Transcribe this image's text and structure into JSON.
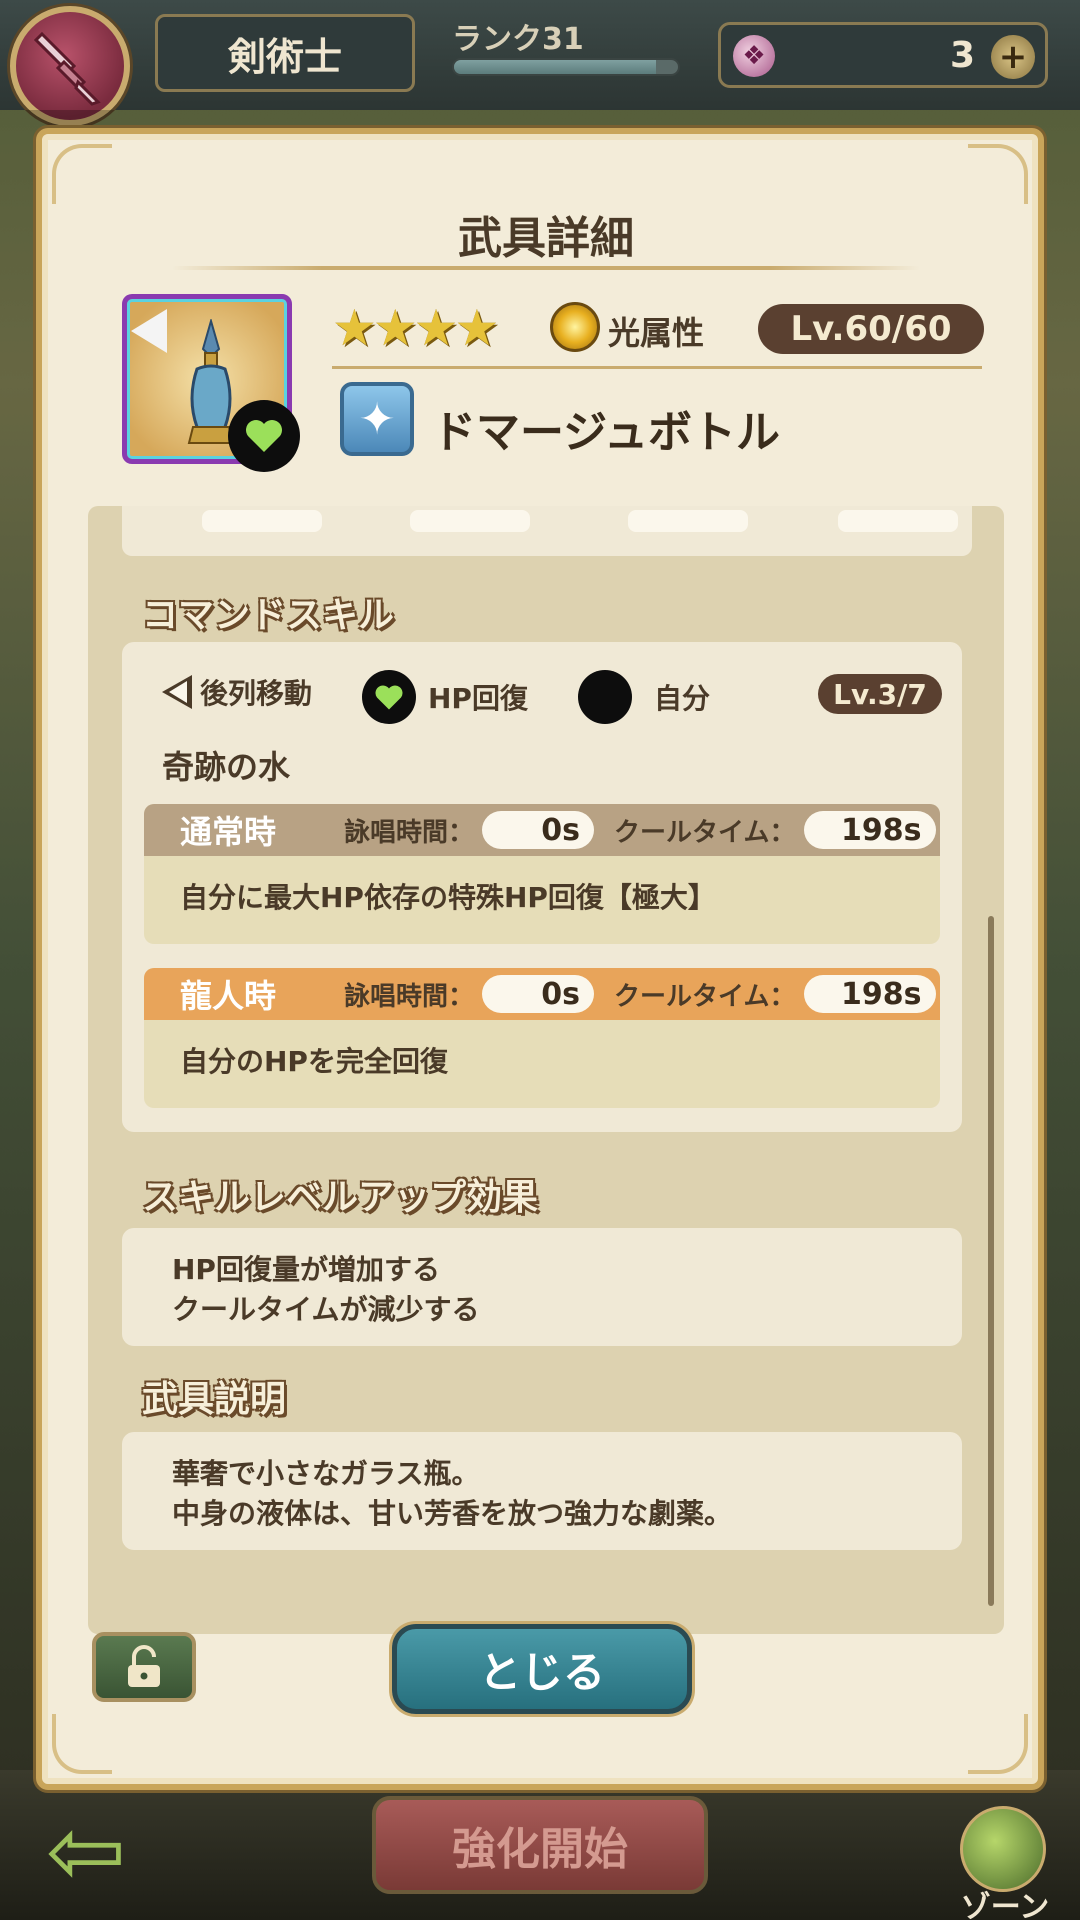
{
  "topbar": {
    "class_name": "剣術士",
    "rank_label": "ランク31",
    "rank_progress": 0.9,
    "currency_value": "3",
    "currency_icon": "stone-icon",
    "plus_icon": "plus-icon"
  },
  "modal": {
    "title": "武具詳細",
    "weapon": {
      "stars": "★★★★",
      "star_count": 4,
      "attribute": "光属性",
      "level": "Lv.60/60",
      "name": "ドマージュボトル",
      "icon": "perfume-bottle-icon",
      "type_icon": "sparkle-icon"
    },
    "command_skill": {
      "section_title": "コマンドスキル",
      "tags": [
        "後列移動",
        "HP回復",
        "自分"
      ],
      "level": "Lv.3/7",
      "skill_name": "奇跡の水",
      "normal": {
        "title": "通常時",
        "cast_label": "詠唱時間：",
        "cast_value": "0s",
        "cool_label": "クールタイム：",
        "cool_value": "198s",
        "description": "自分に最大HP依存の特殊HP回復【極大】"
      },
      "dragon": {
        "title": "龍人時",
        "cast_label": "詠唱時間：",
        "cast_value": "0s",
        "cool_label": "クールタイム：",
        "cool_value": "198s",
        "description": "自分のHPを完全回復"
      }
    },
    "levelup": {
      "section_title": "スキルレベルアップ効果",
      "line1": "HP回復量が増加する",
      "line2": "クールタイムが減少する"
    },
    "description": {
      "section_title": "武具説明",
      "line1": "華奢で小さなガラス瓶。",
      "line2": "中身の液体は、甘い芳香を放つ強力な劇薬。"
    },
    "close_label": "とじる"
  },
  "bottombar": {
    "enhance_label": "強化開始",
    "zone_label": "ゾーン"
  },
  "colors": {
    "accent_gold": "#c9ab6e",
    "normal_header": "#b8a284",
    "dragon_header": "#e8a45a",
    "heart_green": "#9be05a"
  }
}
